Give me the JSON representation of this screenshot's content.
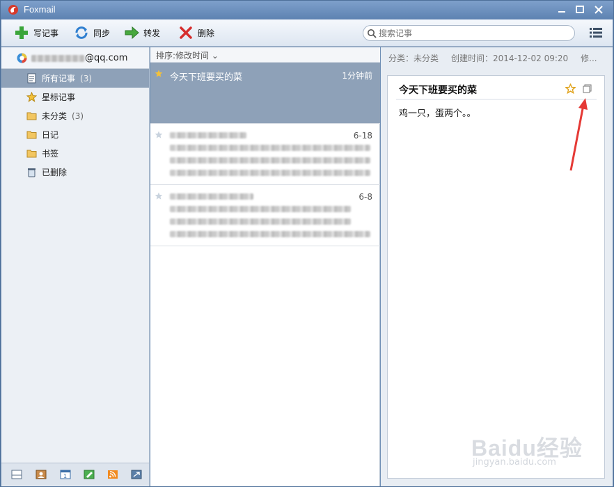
{
  "app": {
    "title": "Foxmail"
  },
  "toolbar": {
    "write_label": "写记事",
    "sync_label": "同步",
    "forward_label": "转发",
    "delete_label": "删除",
    "search_placeholder": "搜索记事"
  },
  "sidebar": {
    "account_email": "@qq.com",
    "items": [
      {
        "label": "所有记事",
        "count": "(3)",
        "icon": "note-icon"
      },
      {
        "label": "星标记事",
        "count": "",
        "icon": "star-icon"
      },
      {
        "label": "未分类",
        "count": "(3)",
        "icon": "folder-icon"
      },
      {
        "label": "日记",
        "count": "",
        "icon": "folder-icon"
      },
      {
        "label": "书签",
        "count": "",
        "icon": "folder-icon"
      },
      {
        "label": "已删除",
        "count": "",
        "icon": "trash-icon"
      }
    ]
  },
  "list": {
    "sort_label": "排序:修改时间",
    "notes": [
      {
        "title": "今天下班要买的菜",
        "date": "1分钟前"
      },
      {
        "title": "",
        "date": "6-18"
      },
      {
        "title": "",
        "date": "6-8"
      }
    ]
  },
  "detail": {
    "category": "分类：未分类",
    "created": "创建时间：2014-12-02 09:20",
    "more": "修...",
    "title": "今天下班要买的菜",
    "body": "鸡一只，蛋两个。。"
  },
  "watermark": {
    "text": "Baidu经验",
    "url": "jingyan.baidu.com"
  },
  "colors": {
    "selection": "#8ea1b8",
    "titlebar": "#6f8fb5",
    "annotation_arrow": "#e53935"
  }
}
